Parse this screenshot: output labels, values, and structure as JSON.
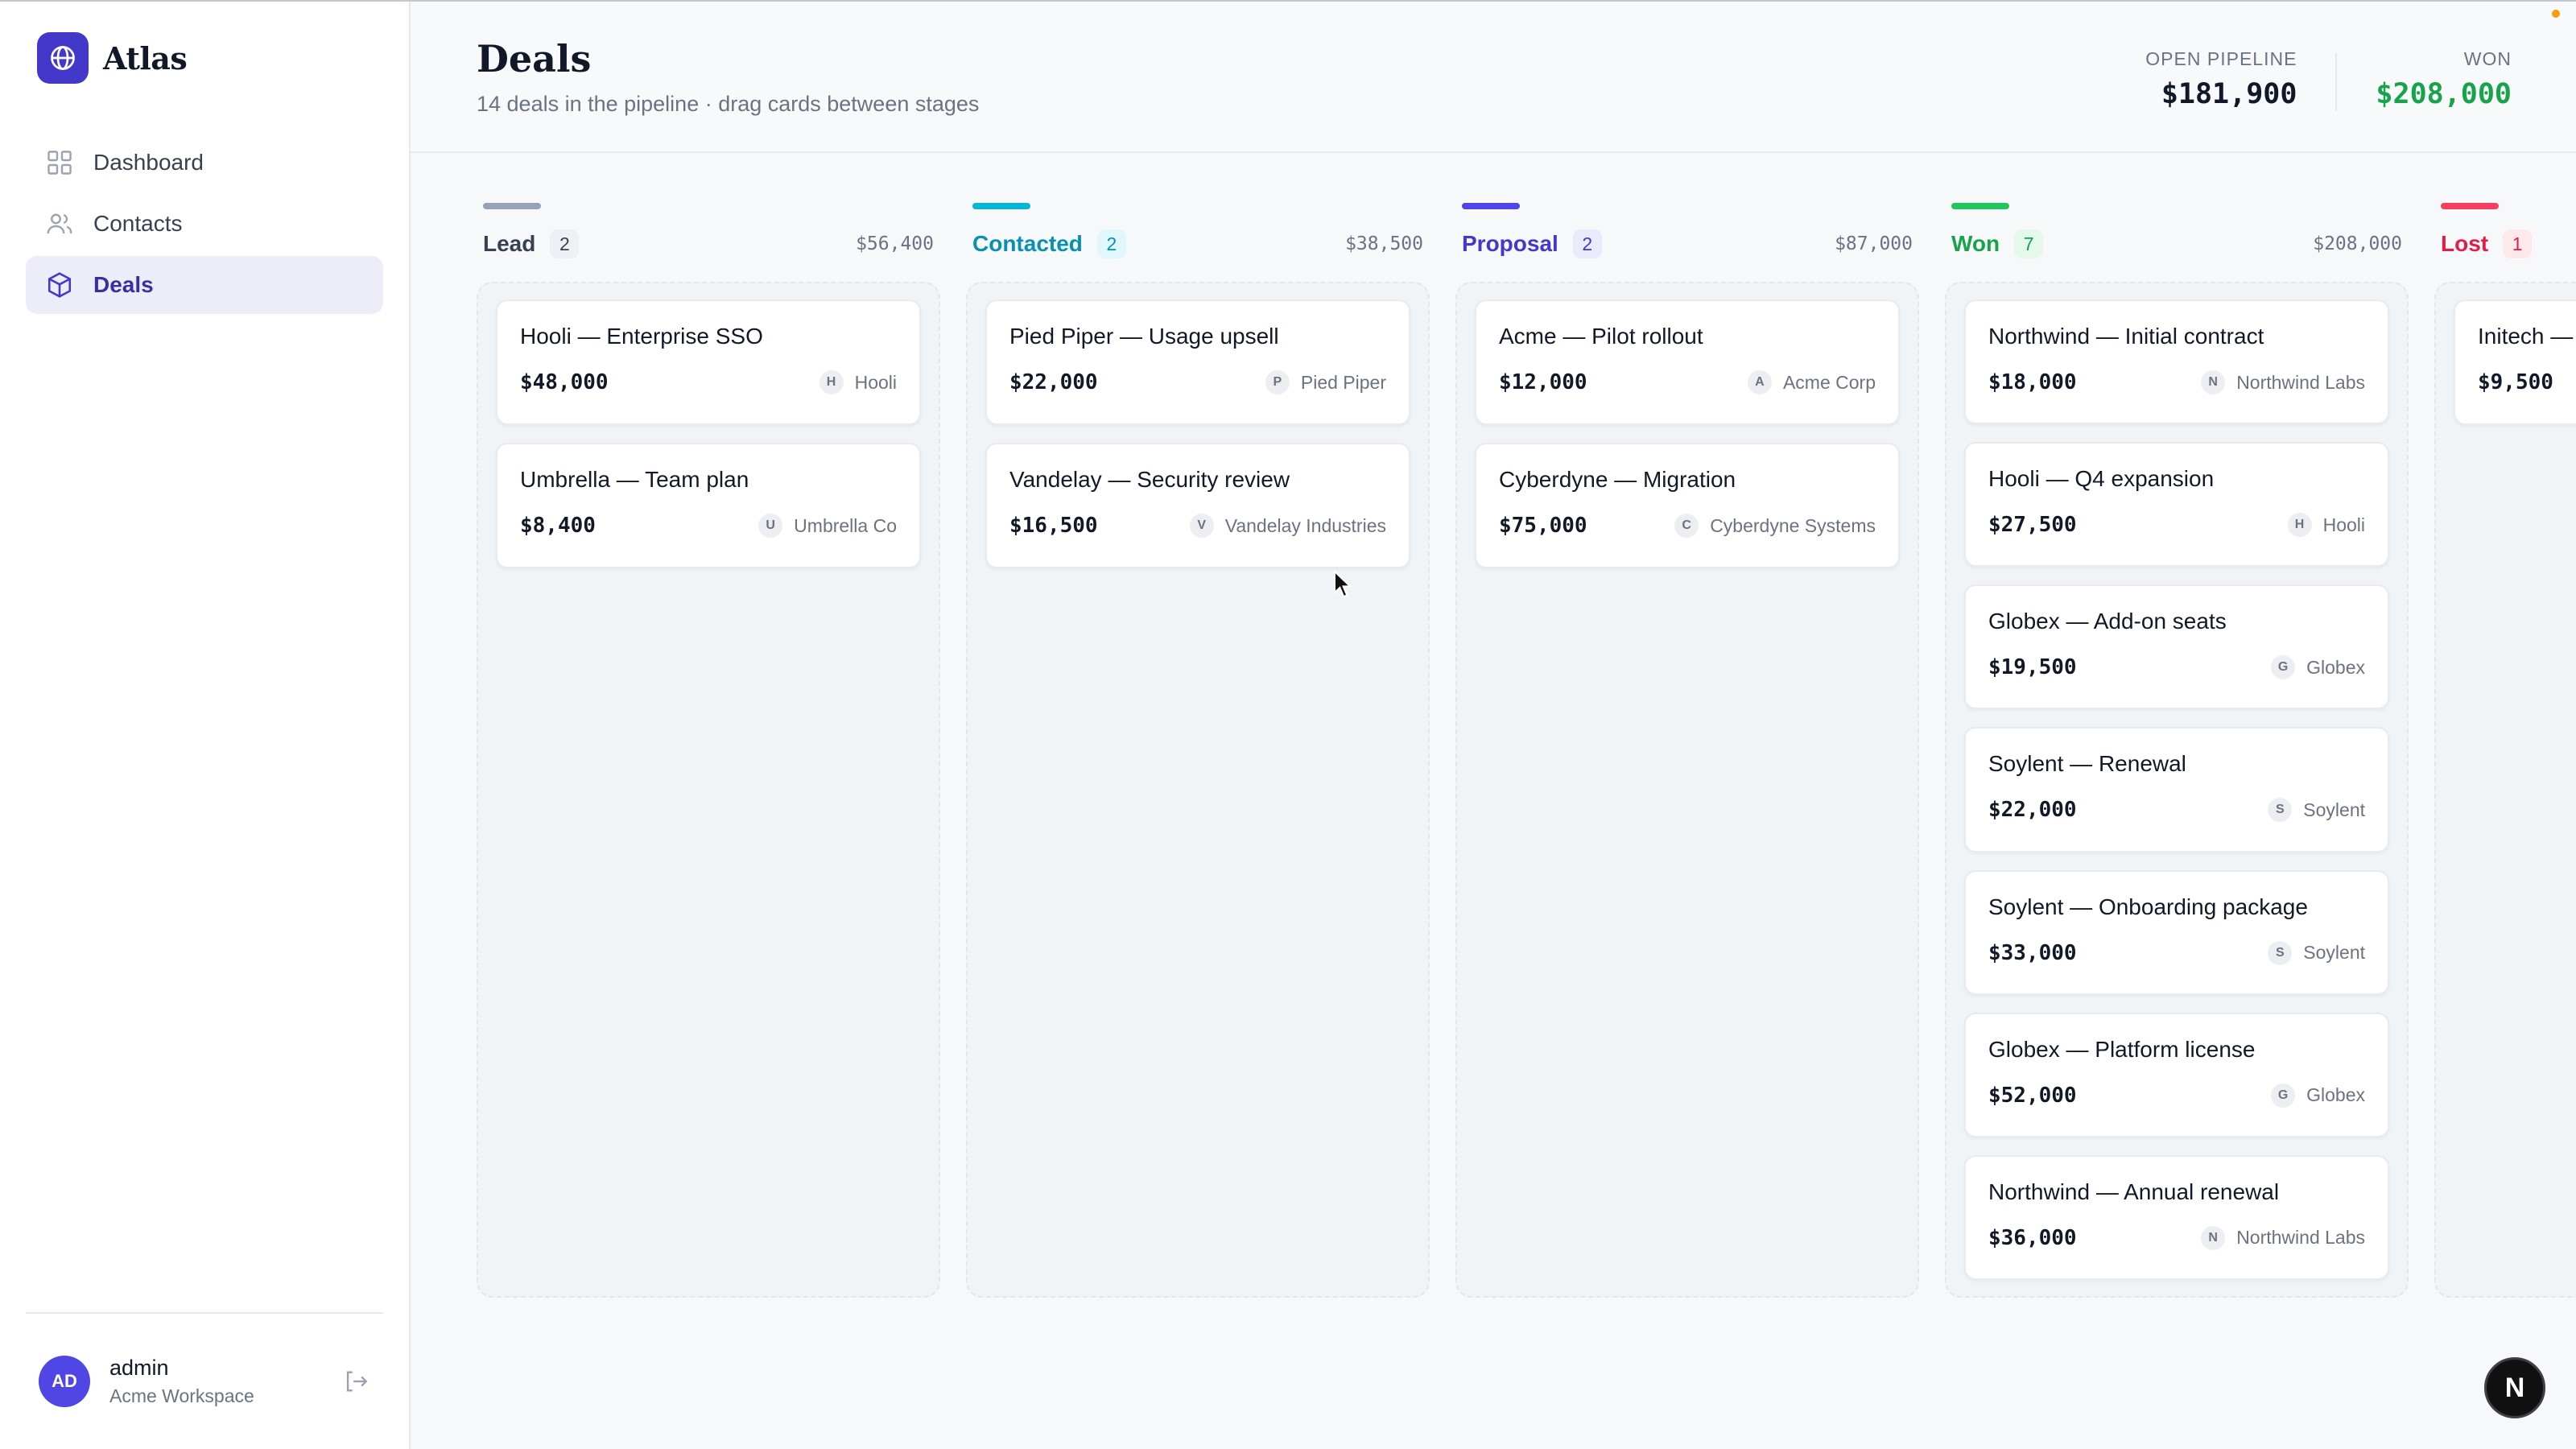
{
  "app": {
    "name": "Atlas"
  },
  "sidebar": {
    "items": [
      {
        "label": "Dashboard",
        "icon": "grid-icon",
        "active": false
      },
      {
        "label": "Contacts",
        "icon": "users-icon",
        "active": false
      },
      {
        "label": "Deals",
        "icon": "box-icon",
        "active": true
      }
    ]
  },
  "user": {
    "initials": "AD",
    "name": "admin",
    "workspace": "Acme Workspace"
  },
  "header": {
    "title": "Deals",
    "subtitle": "14 deals in the pipeline · drag cards between stages",
    "open_pipeline_label": "OPEN PIPELINE",
    "open_pipeline_value": "$181,900",
    "won_label": "WON",
    "won_value": "$208,000"
  },
  "colors": {
    "accent": "#4338ca",
    "lead": "#94a3b8",
    "contacted": "#06b6d4",
    "proposal": "#4f46e5",
    "won": "#22c55e",
    "lost": "#f43f5e"
  },
  "columns": [
    {
      "name": "Lead",
      "count": "2",
      "total": "$56,400",
      "cards": [
        {
          "title": "Hooli — Enterprise SSO",
          "amount": "$48,000",
          "initial": "H",
          "company": "Hooli"
        },
        {
          "title": "Umbrella — Team plan",
          "amount": "$8,400",
          "initial": "U",
          "company": "Umbrella Co"
        }
      ]
    },
    {
      "name": "Contacted",
      "count": "2",
      "total": "$38,500",
      "cards": [
        {
          "title": "Pied Piper — Usage upsell",
          "amount": "$22,000",
          "initial": "P",
          "company": "Pied Piper"
        },
        {
          "title": "Vandelay — Security review",
          "amount": "$16,500",
          "initial": "V",
          "company": "Vandelay Industries"
        }
      ]
    },
    {
      "name": "Proposal",
      "count": "2",
      "total": "$87,000",
      "cards": [
        {
          "title": "Acme — Pilot rollout",
          "amount": "$12,000",
          "initial": "A",
          "company": "Acme Corp"
        },
        {
          "title": "Cyberdyne — Migration",
          "amount": "$75,000",
          "initial": "C",
          "company": "Cyberdyne Systems"
        }
      ]
    },
    {
      "name": "Won",
      "count": "7",
      "total": "$208,000",
      "cards": [
        {
          "title": "Northwind — Initial contract",
          "amount": "$18,000",
          "initial": "N",
          "company": "Northwind Labs"
        },
        {
          "title": "Hooli — Q4 expansion",
          "amount": "$27,500",
          "initial": "H",
          "company": "Hooli"
        },
        {
          "title": "Globex — Add-on seats",
          "amount": "$19,500",
          "initial": "G",
          "company": "Globex"
        },
        {
          "title": "Soylent — Renewal",
          "amount": "$22,000",
          "initial": "S",
          "company": "Soylent"
        },
        {
          "title": "Soylent — Onboarding package",
          "amount": "$33,000",
          "initial": "S",
          "company": "Soylent"
        },
        {
          "title": "Globex — Platform license",
          "amount": "$52,000",
          "initial": "G",
          "company": "Globex"
        },
        {
          "title": "Northwind — Annual renewal",
          "amount": "$36,000",
          "initial": "N",
          "company": "Northwind Labs"
        }
      ]
    },
    {
      "name": "Lost",
      "count": "1",
      "total": "",
      "cards": [
        {
          "title": "Initech —",
          "amount": "$9,500",
          "initial": "",
          "company": ""
        }
      ]
    }
  ],
  "fab_label": "N"
}
